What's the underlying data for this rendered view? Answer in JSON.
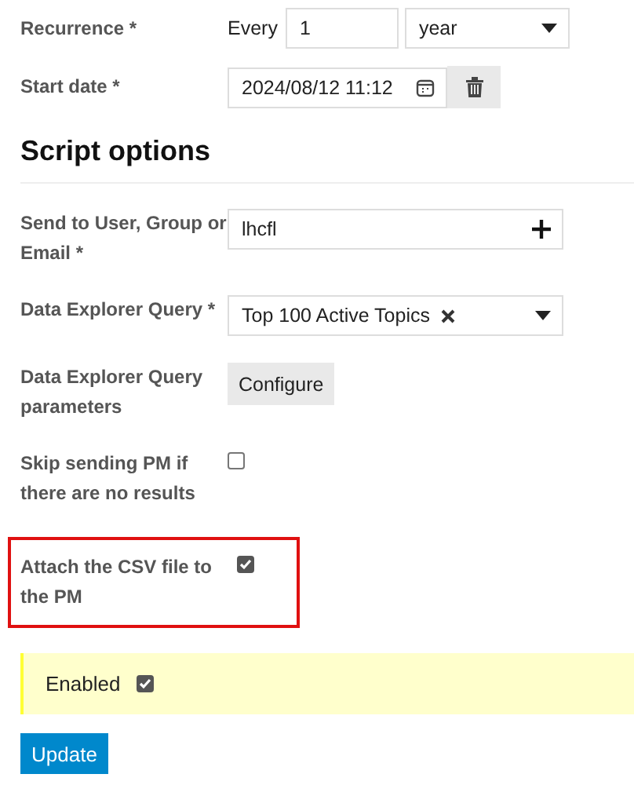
{
  "schedule": [
    {
      "kind": "recurrence",
      "label": "Recurrence *",
      "prefix": "Every",
      "value": "1",
      "unit": "year"
    },
    {
      "kind": "datetime",
      "label": "Start date *",
      "value": "2024/08/12  11:12"
    }
  ],
  "section_title": "Script options",
  "options": [
    {
      "kind": "user",
      "label": "Send to User, Group or Email *",
      "value": "lhcfl"
    },
    {
      "kind": "select",
      "label": "Data Explorer Query *",
      "value": "Top 100 Active Topics"
    },
    {
      "kind": "button",
      "label": "Data Explorer Query parameters",
      "button": "Configure"
    },
    {
      "kind": "checkbox",
      "label": "Skip sending PM if there are no results",
      "checked": false,
      "highlighted": false
    },
    {
      "kind": "checkbox",
      "label": "Attach the CSV file to the PM",
      "checked": true,
      "highlighted": true
    }
  ],
  "enabled": {
    "label": "Enabled",
    "checked": true
  },
  "submit": "Update"
}
